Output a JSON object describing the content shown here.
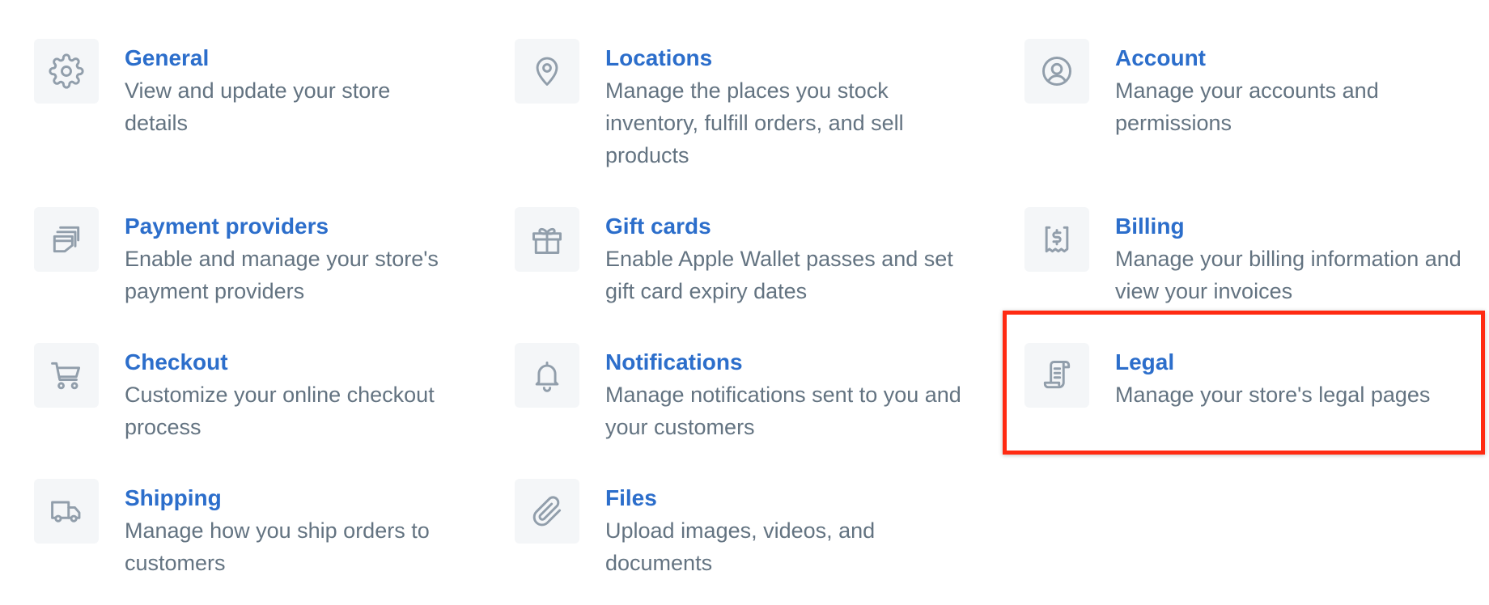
{
  "settings": {
    "items": [
      {
        "key": "general",
        "title": "General",
        "description": "View and update your store details",
        "icon": "gear-icon"
      },
      {
        "key": "locations",
        "title": "Locations",
        "description": "Manage the places you stock inventory, fulfill orders, and sell products",
        "icon": "map-pin-icon"
      },
      {
        "key": "account",
        "title": "Account",
        "description": "Manage your accounts and permissions",
        "icon": "user-circle-icon"
      },
      {
        "key": "payment",
        "title": "Payment providers",
        "description": "Enable and manage your store's payment providers",
        "icon": "payment-icon"
      },
      {
        "key": "giftcards",
        "title": "Gift cards",
        "description": "Enable Apple Wallet passes and set gift card expiry dates",
        "icon": "gift-icon"
      },
      {
        "key": "billing",
        "title": "Billing",
        "description": "Manage your billing information and view your invoices",
        "icon": "receipt-dollar-icon"
      },
      {
        "key": "checkout",
        "title": "Checkout",
        "description": "Customize your online checkout process",
        "icon": "cart-icon"
      },
      {
        "key": "notifications",
        "title": "Notifications",
        "description": "Manage notifications sent to you and your customers",
        "icon": "bell-icon"
      },
      {
        "key": "legal",
        "title": "Legal",
        "description": "Manage your store's legal pages",
        "icon": "legal-scroll-icon"
      },
      {
        "key": "shipping",
        "title": "Shipping",
        "description": "Manage how you ship orders to customers",
        "icon": "truck-icon"
      },
      {
        "key": "files",
        "title": "Files",
        "description": "Upload images, videos, and documents",
        "icon": "paperclip-icon"
      }
    ]
  },
  "colors": {
    "link": "#2c6ecb",
    "description": "#637381",
    "icon": "#919eab",
    "icon_background": "#f4f6f8",
    "highlight": "#ff2a12"
  }
}
